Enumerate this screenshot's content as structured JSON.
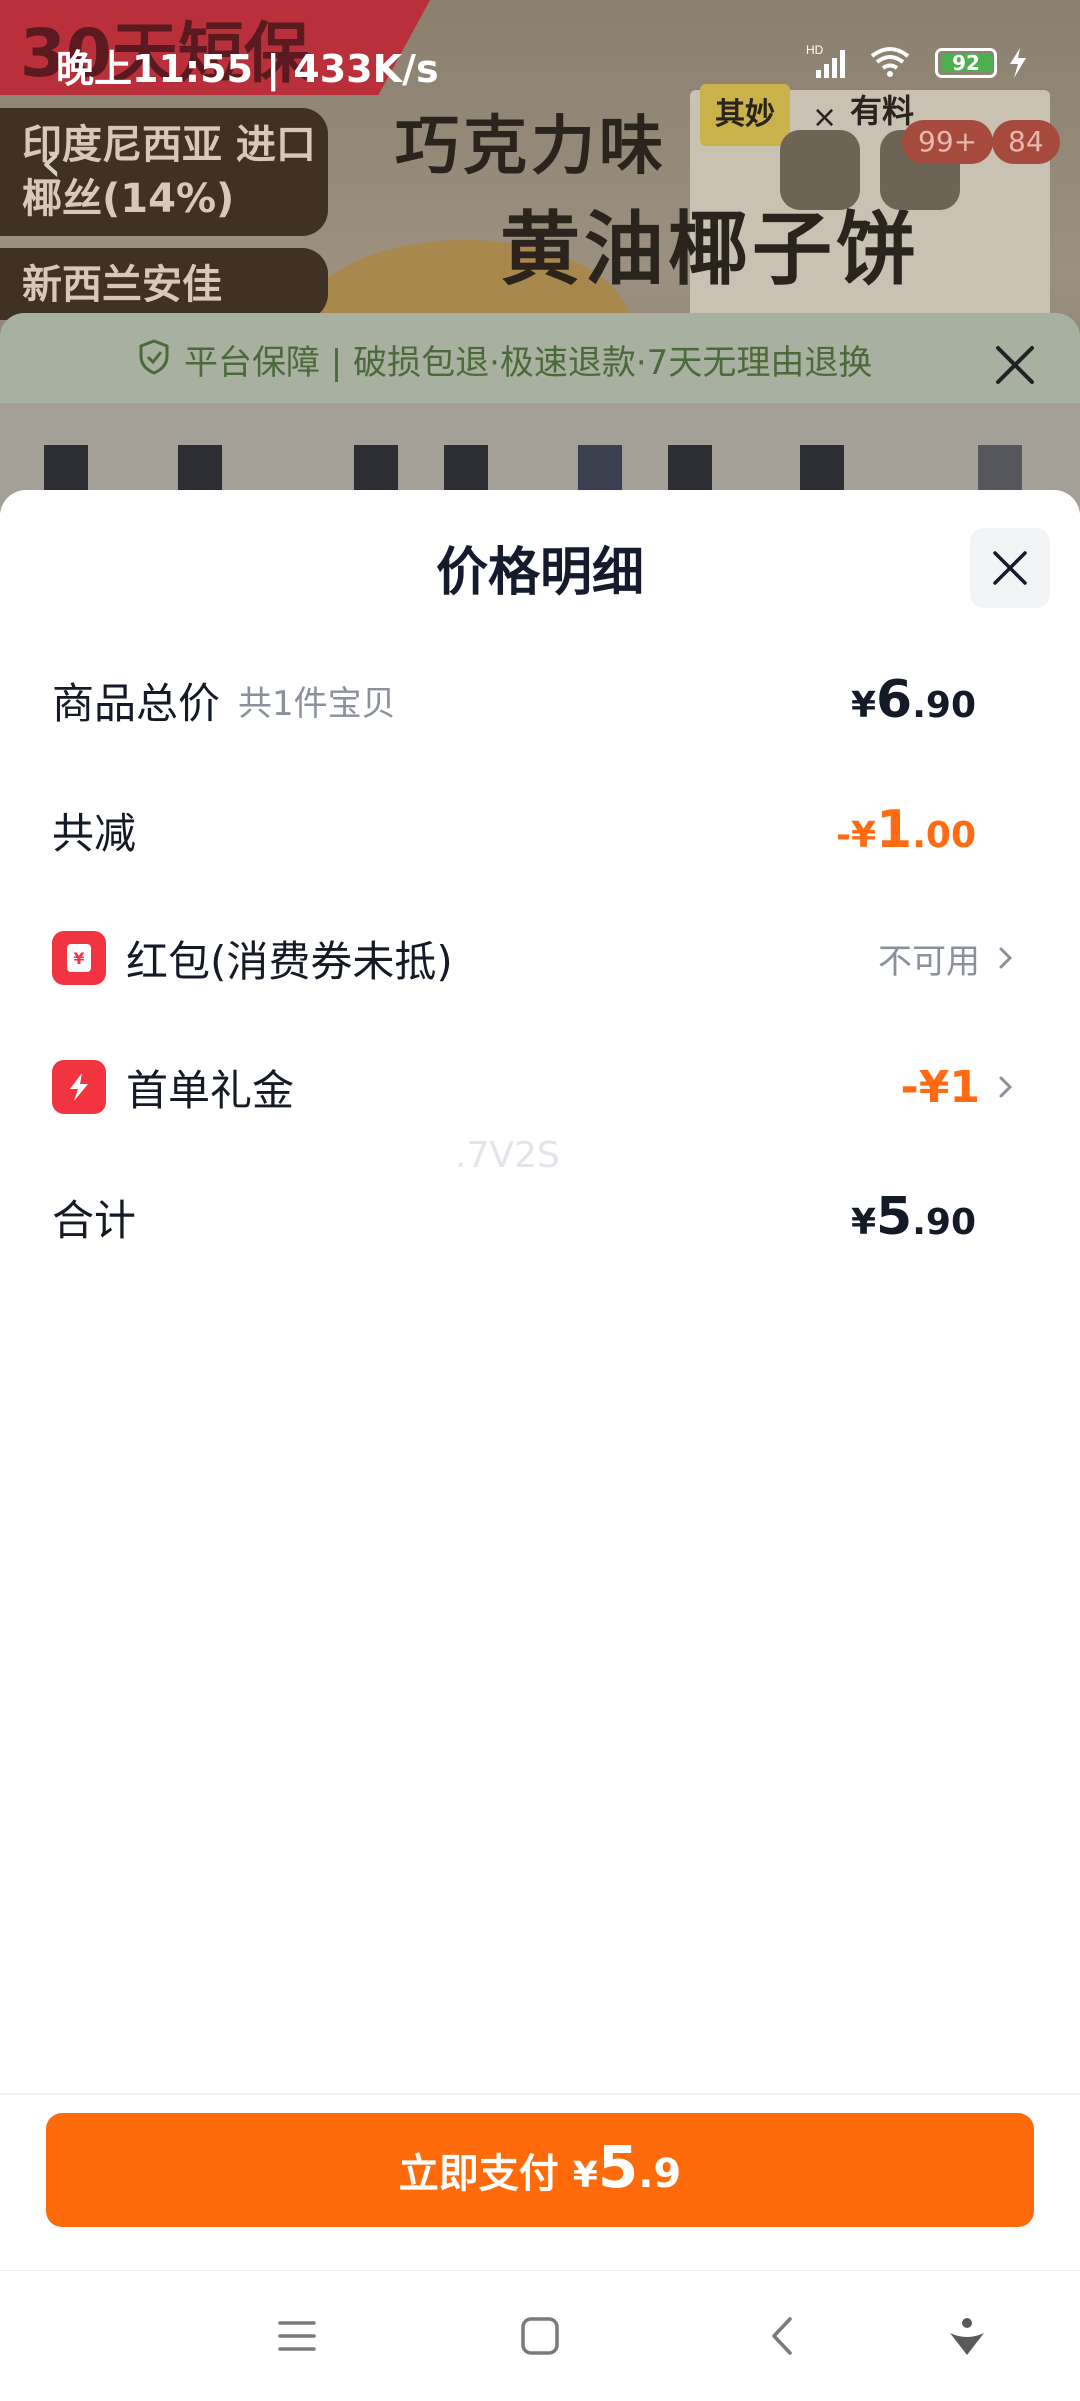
{
  "status_bar": {
    "time": "晚上11:55 | 433K/s",
    "battery": "92"
  },
  "background": {
    "ribbon": "30天短保",
    "tag1": "印度尼西亚 进口椰丝(14%)",
    "tag2": "新西兰安佳",
    "headline1": "巧克力味",
    "headline2": "黄油椰子饼",
    "brand": "其妙",
    "brand_x": "×",
    "brand2": "有料",
    "badge_cart": "99+",
    "badge_msg": "84",
    "guarantee": "平台保障 | 破损包退·极速退款·7天无理由退换"
  },
  "sheet": {
    "title": "价格明细",
    "rows": [
      {
        "label": "商品总价",
        "sub": "共1件宝贝",
        "currency": "¥",
        "int": "6",
        "dec": ".90"
      },
      {
        "label": "共减",
        "currency": "-¥",
        "int": "1",
        "dec": ".00"
      },
      {
        "label": "红包(消费券未抵)",
        "link": "不可用"
      },
      {
        "label": "首单礼金",
        "value": "-¥1"
      },
      {
        "label": "合计",
        "currency": "¥",
        "int": "5",
        "dec": ".90"
      }
    ],
    "watermark": ".7V2S"
  },
  "pay_button": {
    "label": "立即支付",
    "currency": "¥",
    "int": "5",
    "dec": ".9"
  },
  "colors": {
    "accent": "#ff6a0a",
    "discount": "#ff6a12",
    "icon_red": "#f23340"
  }
}
